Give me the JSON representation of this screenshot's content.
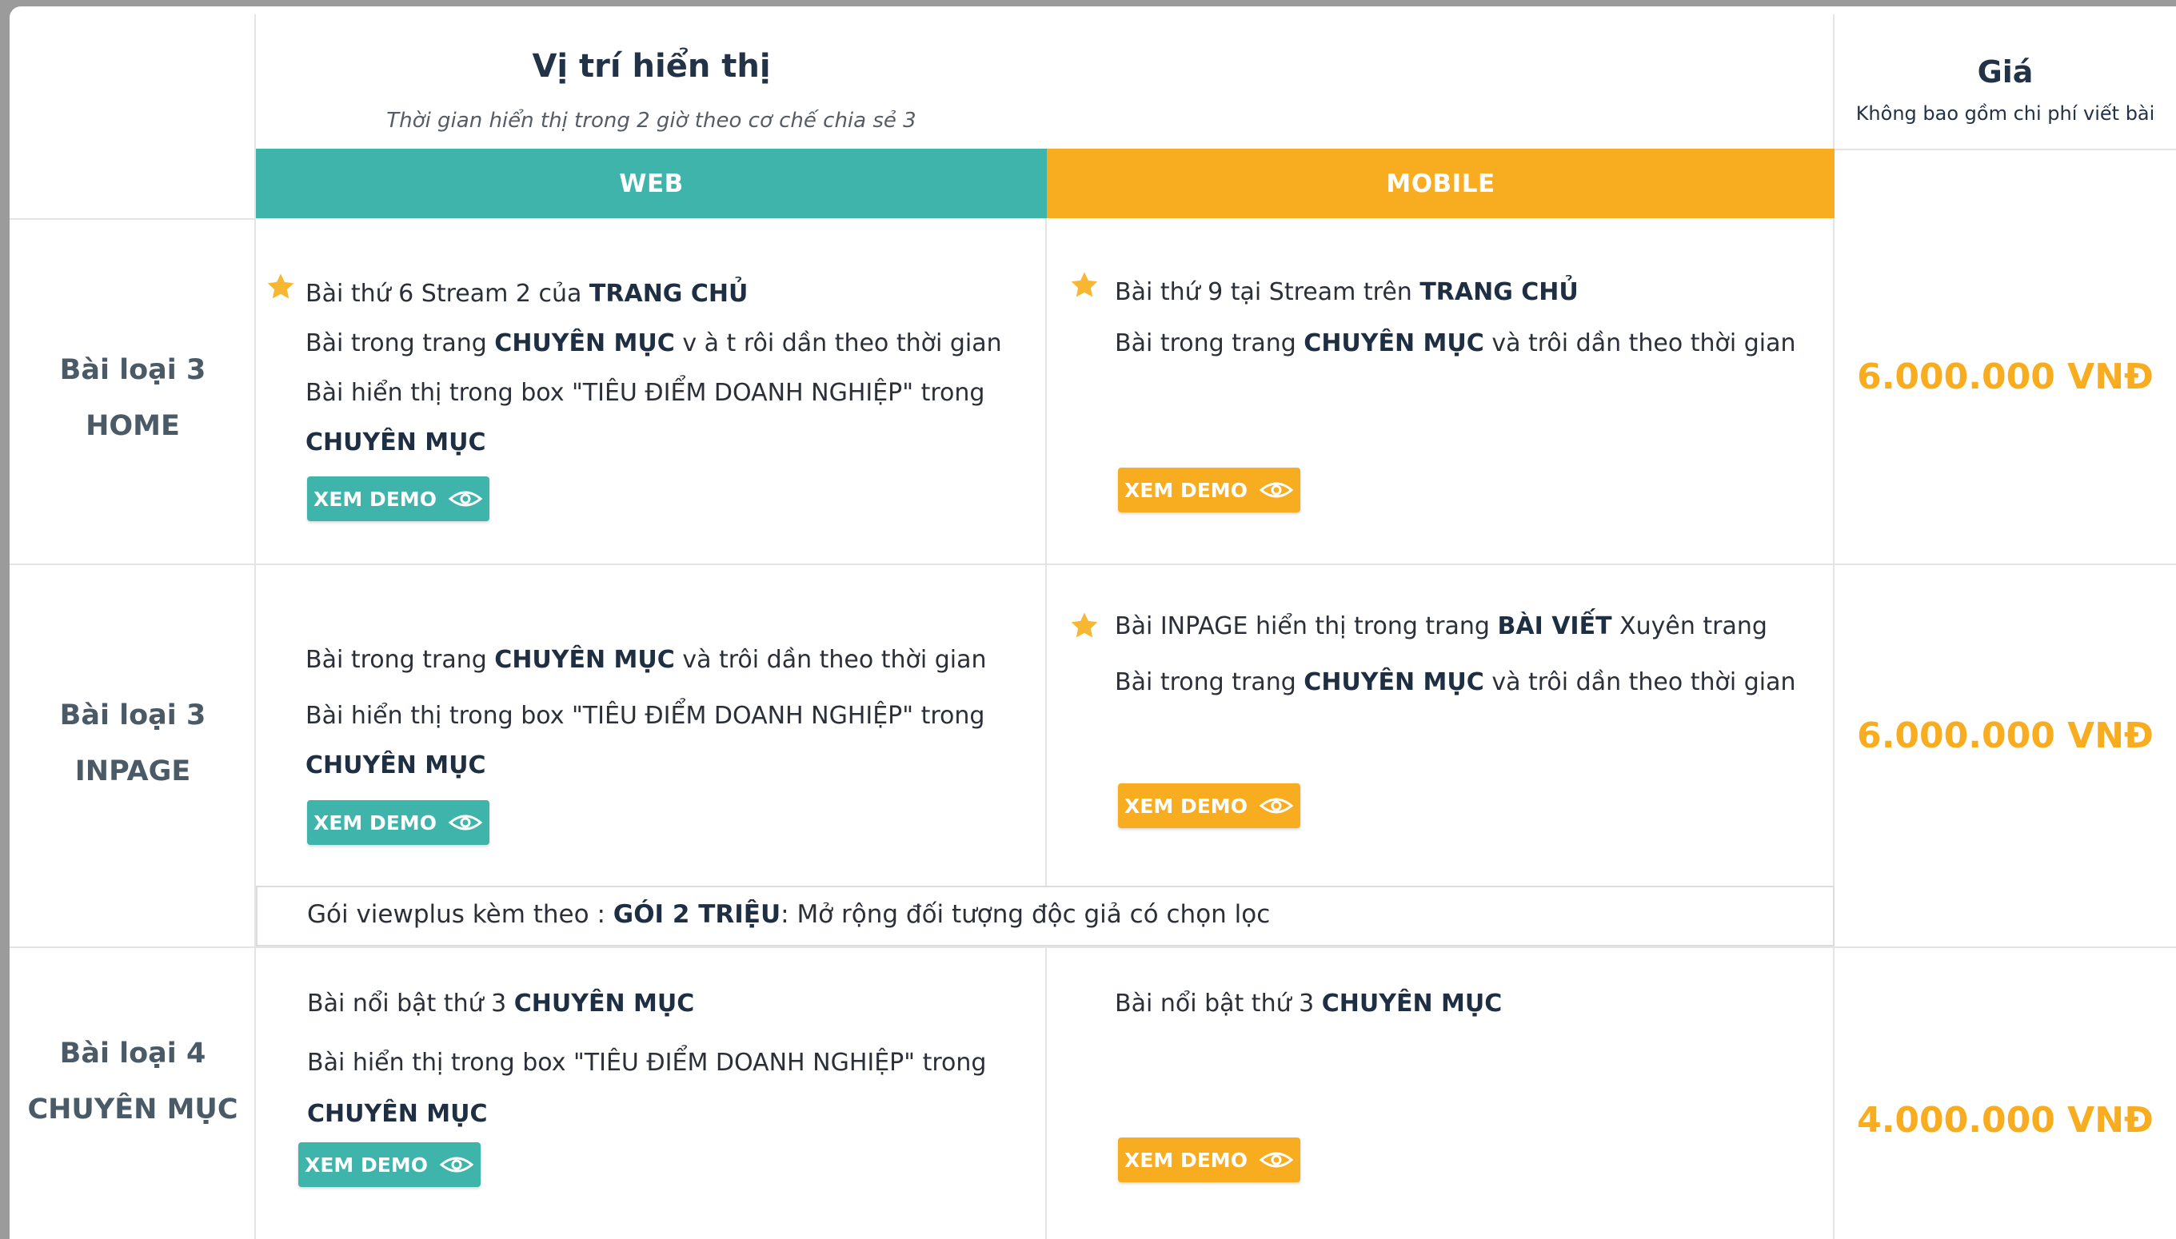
{
  "header": {
    "title": "Vị trí hiển thị",
    "subtitle": "Thời gian hiển thị trong 2 giờ theo cơ chế chia sẻ 3",
    "web_label": "WEB",
    "mobile_label": "MOBILE",
    "price_title": "Giá",
    "price_subtitle": "Không bao gồm chi phí viết bài"
  },
  "demo_label": "XEM DEMO",
  "icons": {
    "star": "star-icon",
    "eye": "eye-icon"
  },
  "colors": {
    "teal": "#3eb4ab",
    "orange": "#f8ac1f",
    "text_dark": "#223347"
  },
  "rows": [
    {
      "label_line1": "Bài loại 3",
      "label_line2": "HOME",
      "price": "6.000.000 VNĐ",
      "web": {
        "l1_pre": "Bài thứ 6 Stream 2 của ",
        "l1_bold": "TRANG CHỦ",
        "l2_pre": "Bài trong trang ",
        "l2_bold": "CHUYÊN MỤC",
        "l2_post": " v à t rôi dần theo thời gian",
        "l3": "Bài hiển thị trong box \"TIÊU ĐIỂM DOANH NGHIỆP\" trong",
        "l4_bold": "CHUYÊN MỤC"
      },
      "mobile": {
        "l1_pre": "Bài thứ 9 tại Stream trên ",
        "l1_bold": "TRANG CHỦ",
        "l2_pre": "Bài trong trang ",
        "l2_bold": "CHUYÊN MỤC",
        "l2_post": " và trôi dần theo thời gian"
      }
    },
    {
      "label_line1": "Bài loại 3",
      "label_line2": "INPAGE",
      "price": "6.000.000 VNĐ",
      "web": {
        "l1_pre": "Bài trong trang ",
        "l1_bold": "CHUYÊN MỤC",
        "l1_post": " và trôi dần theo thời gian",
        "l2": "Bài hiển thị trong box \"TIÊU ĐIỂM DOANH NGHIỆP\" trong",
        "l3_bold": "CHUYÊN MỤC"
      },
      "mobile": {
        "l1_pre": "Bài INPAGE hiển thị trong trang ",
        "l1_bold": "BÀI VIẾT",
        "l1_post": " Xuyên trang",
        "l2_pre": "Bài trong trang ",
        "l2_bold": "CHUYÊN MỤC",
        "l2_post": " và trôi dần theo thời gian"
      },
      "viewplus": {
        "pre": "Gói viewplus kèm theo : ",
        "bold": "GÓI 2 TRIỆU",
        "post": ": Mở rộng đối tượng độc giả có chọn lọc"
      }
    },
    {
      "label_line1": "Bài loại 4",
      "label_line2": "CHUYÊN MỤC",
      "price": "4.000.000 VNĐ",
      "web": {
        "l1_pre": "Bài nổi bật thứ 3 ",
        "l1_bold": "CHUYÊN MỤC",
        "l2": "Bài hiển thị trong box \"TIÊU ĐIỂM DOANH NGHIỆP\" trong",
        "l3_bold": "CHUYÊN MỤC"
      },
      "mobile": {
        "l1_pre": "Bài nổi bật thứ 3 ",
        "l1_bold": "CHUYÊN MỤC"
      }
    }
  ]
}
